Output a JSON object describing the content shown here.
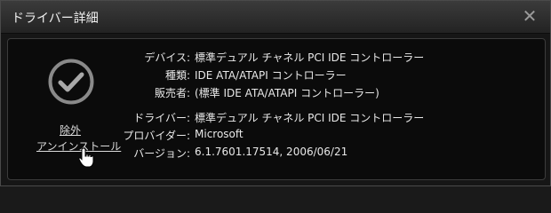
{
  "window": {
    "title": "ドライバー詳細",
    "close_glyph": "✕"
  },
  "status": {
    "icon": "checkmark-circle-icon"
  },
  "actions": {
    "exclude_label": "除外",
    "uninstall_label": "アンインストール"
  },
  "device_info": [
    {
      "label": "デバイス:",
      "value": "標準デュアル チャネル PCI IDE コントローラー"
    },
    {
      "label": "種類:",
      "value": "IDE ATA/ATAPI コントローラー"
    },
    {
      "label": "販売者:",
      "value": "(標準 IDE ATA/ATAPI コントローラー)"
    }
  ],
  "driver_info": [
    {
      "label": "ドライバー:",
      "value": "標準デュアル チャネル PCI IDE コントローラー"
    },
    {
      "label": "プロバイダー:",
      "value": "Microsoft"
    },
    {
      "label": "バージョン:",
      "value": "6.1.7601.17514, 2006/06/21"
    }
  ],
  "colors": {
    "background": "#161616",
    "panel": "#0b0b0b",
    "text": "#e8e8e8"
  }
}
